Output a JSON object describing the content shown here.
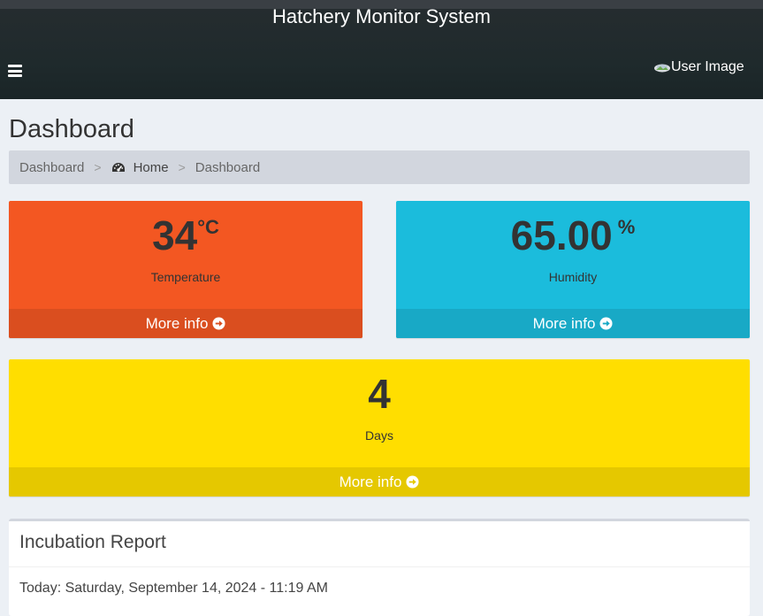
{
  "header": {
    "title": "Hatchery Monitor System",
    "menu_icon": "hamburger-menu-icon",
    "user_image_alt": "User Image"
  },
  "page": {
    "title": "Dashboard"
  },
  "breadcrumb": {
    "items": [
      "Dashboard",
      "Home",
      "Dashboard"
    ],
    "home_icon": "dashboard-gauge-icon",
    "separator": ">"
  },
  "cards": {
    "temperature": {
      "value": "34",
      "unit": "°C",
      "label": "Temperature",
      "link": "More info",
      "color": "#f35722"
    },
    "humidity": {
      "value": "65.00",
      "unit": "%",
      "label": "Humidity",
      "link": "More info",
      "color": "#1bbcdc"
    },
    "days": {
      "value": "4",
      "label": "Days",
      "link": "More info",
      "color": "#ffde00"
    }
  },
  "report": {
    "title": "Incubation Report",
    "today": "Today: Saturday, September 14, 2024 - 11:19 AM"
  }
}
